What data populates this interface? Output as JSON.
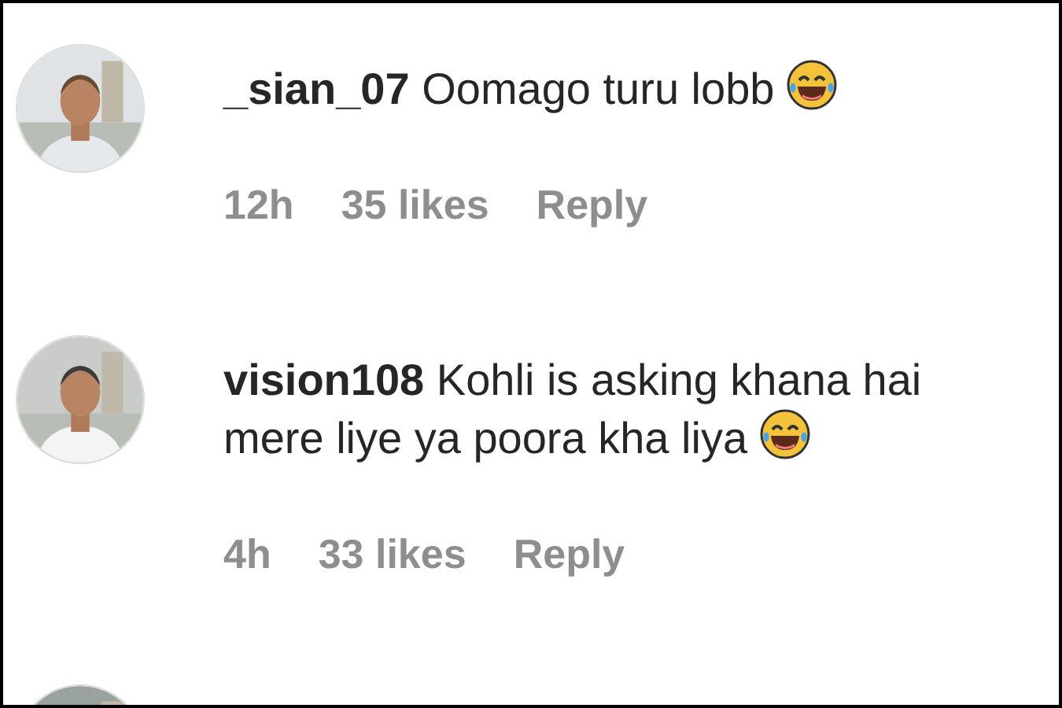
{
  "comments": [
    {
      "username": "_sian_07",
      "text": "Oomago turu lobb",
      "emoji": true,
      "time": "12h",
      "likes": "35 likes",
      "reply": "Reply",
      "avatar": {
        "kind": "picture"
      }
    },
    {
      "username": "vision108",
      "text": "Kohli is asking khana hai mere liye ya poora kha liya",
      "emoji": true,
      "time": "4h",
      "likes": "33 likes",
      "reply": "Reply",
      "avatar": {
        "kind": "picture"
      }
    },
    {
      "avatar": {
        "kind": "picture"
      }
    }
  ]
}
